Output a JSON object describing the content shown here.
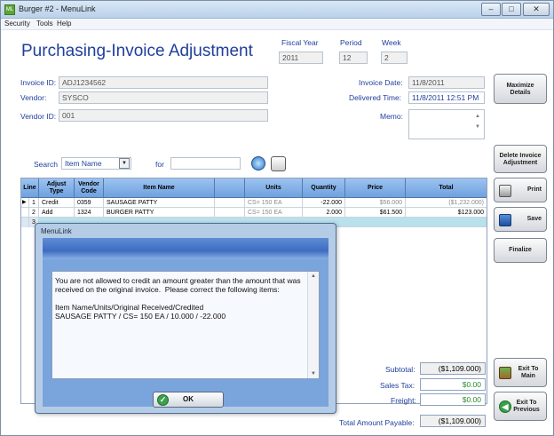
{
  "window": {
    "title": "Burger #2 - MenuLink",
    "app_icon": "ML"
  },
  "menubar": [
    "Security",
    "Tools",
    "Help"
  ],
  "page": {
    "title": "Purchasing-Invoice Adjustment"
  },
  "period": {
    "fiscal_year_label": "Fiscal Year",
    "fiscal_year": "2011",
    "period_label": "Period",
    "period": "12",
    "week_label": "Week",
    "week": "2"
  },
  "invoice": {
    "invoice_id_label": "Invoice ID:",
    "invoice_id": "ADJ1234562",
    "vendor_label": "Vendor:",
    "vendor": "SYSCO",
    "vendor_id_label": "Vendor ID:",
    "vendor_id": "001",
    "invoice_date_label": "Invoice Date:",
    "invoice_date": "11/8/2011",
    "delivered_time_label": "Delivered Time:",
    "delivered_time": "11/8/2011 12:51 PM",
    "memo_label": "Memo:",
    "memo": ""
  },
  "search": {
    "label": "Search",
    "field": "Item Name",
    "for_label": "for",
    "value": ""
  },
  "grid": {
    "headers": [
      "Line",
      "Adjust Type",
      "Vendor Code",
      "Item Name",
      "",
      "Units",
      "Quantity",
      "Price",
      "Total"
    ],
    "rows": [
      {
        "line": "1",
        "type": "Credit",
        "code": "0359",
        "item": "SAUSAGE PATTY",
        "units": "CS= 150 EA",
        "qty": "-22.000",
        "price": "$56.000",
        "total": "($1,232.000)"
      },
      {
        "line": "2",
        "type": "Add",
        "code": "1324",
        "item": "BURGER PATTY",
        "units": "CS= 150 EA",
        "qty": "2.000",
        "price": "$61.500",
        "total": "$123.000"
      },
      {
        "line": "3",
        "type": "",
        "code": "",
        "item": "",
        "units": "",
        "qty": "",
        "price": "",
        "total": ""
      }
    ]
  },
  "totals": {
    "subtotal_label": "Subtotal:",
    "subtotal": "($1,109.000)",
    "sales_tax_label": "Sales Tax:",
    "sales_tax": "$0.00",
    "freight_label": "Freight:",
    "freight": "$0.00",
    "total_label": "Total Amount Payable:",
    "total": "($1,109.000)"
  },
  "actions": {
    "maximize": "Maximize Details",
    "delete": "Delete Invoice Adjustment",
    "print": "Print",
    "save": "Save",
    "finalize": "Finalize",
    "exit_main": "Exit To Main",
    "exit_previous": "Exit To Previous"
  },
  "dialog": {
    "title": "MenuLink",
    "message": "You are not allowed to credit an amount greater than the amount that was received on the original invoice.  Please correct the following items:\n\nItem Name/Units/Original Received/Credited\nSAUSAGE PATTY / CS= 150 EA / 10.000 / -22.000",
    "ok": "OK"
  }
}
